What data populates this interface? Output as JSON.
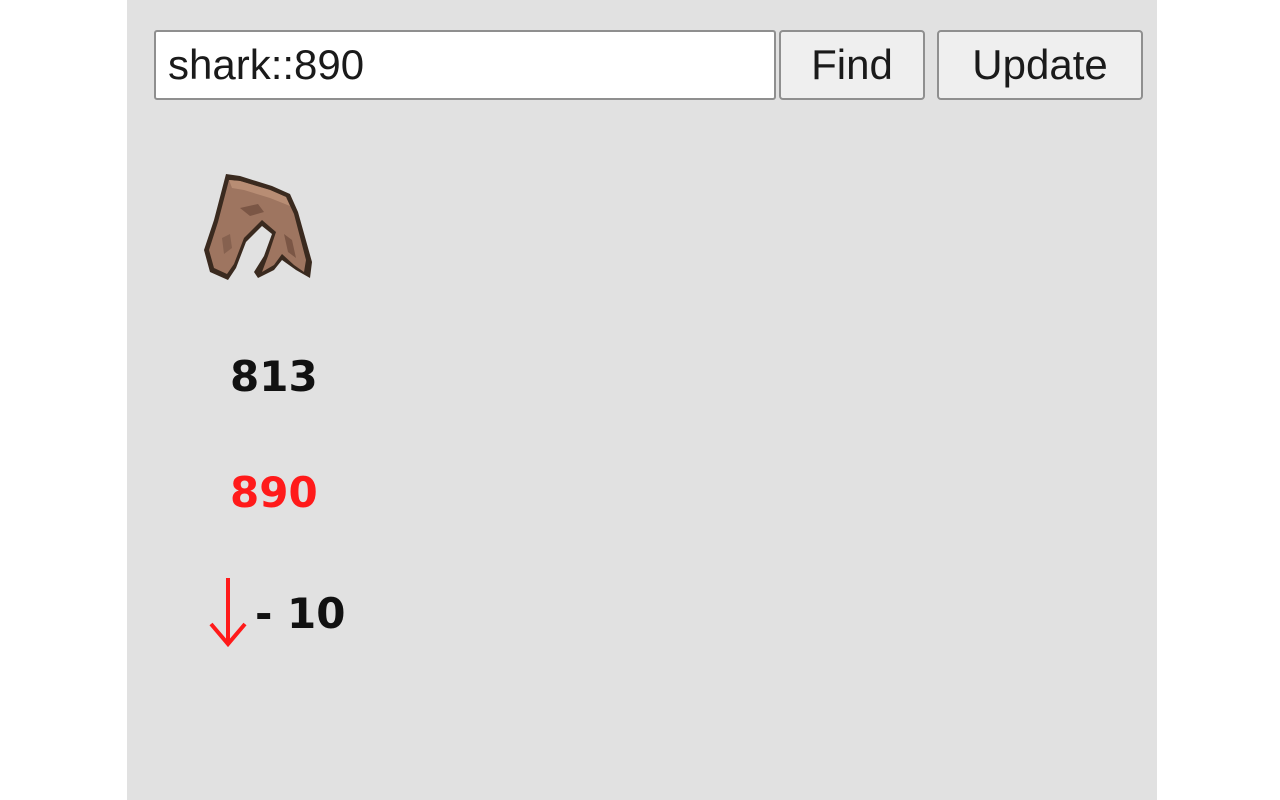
{
  "search": {
    "value": "shark::890"
  },
  "buttons": {
    "find_label": "Find",
    "update_label": "Update"
  },
  "item": {
    "icon": "raw-shark-icon",
    "current_value": "813",
    "target_value": "890",
    "change_value": "- 10",
    "change_direction_icon": "down-arrow-icon"
  },
  "colors": {
    "panel_background": "#e1e1e1",
    "target_value": "#ff1a1a",
    "down_arrow": "#ff1a1a"
  }
}
